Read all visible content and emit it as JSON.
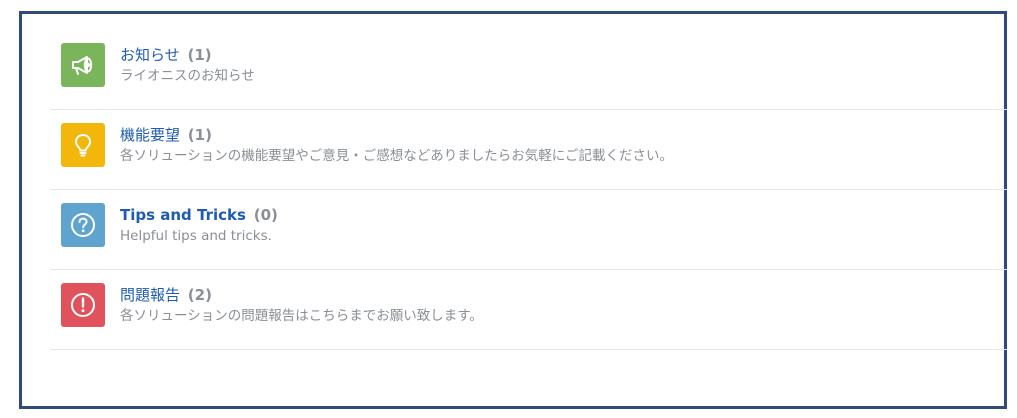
{
  "forums": [
    {
      "title": "お知らせ",
      "count": "(1)",
      "description": "ライオニスのお知らせ",
      "icon": "megaphone-icon",
      "color": "#7ab55c"
    },
    {
      "title": "機能要望",
      "count": "(1)",
      "description": "各ソリューションの機能要望やご意見・ご感想などありましたらお気軽にご記載ください。",
      "icon": "lightbulb-icon",
      "color": "#f2b70a"
    },
    {
      "title": "Tips and Tricks",
      "count": "(0)",
      "description": "Helpful tips and tricks.",
      "icon": "question-circle-icon",
      "color": "#5fa4cf"
    },
    {
      "title": "問題報告",
      "count": "(2)",
      "description": "各ソリューションの問題報告はこちらまでお願い致します。",
      "icon": "exclamation-circle-icon",
      "color": "#e0535d"
    }
  ]
}
